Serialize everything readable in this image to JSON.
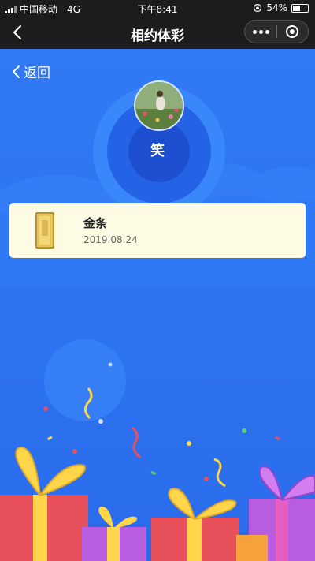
{
  "status_bar": {
    "carrier": "中国移动",
    "network": "4G",
    "time": "下午8:41",
    "battery_percent": "54%",
    "battery_level": 0.54
  },
  "nav": {
    "title": "相约体彩",
    "back_icon": "chevron-left-icon",
    "more_icon": "more-dots-icon",
    "close_icon": "miniprogram-close-icon"
  },
  "page": {
    "back_label": "返回",
    "user": {
      "name": "笑"
    },
    "prize": {
      "name": "金条",
      "date": "2019.08.24",
      "icon": "gold-bar-icon"
    }
  },
  "colors": {
    "background": "#2d72f0",
    "card": "#fdfbe4",
    "nav_bar": "#1c1c1e"
  }
}
